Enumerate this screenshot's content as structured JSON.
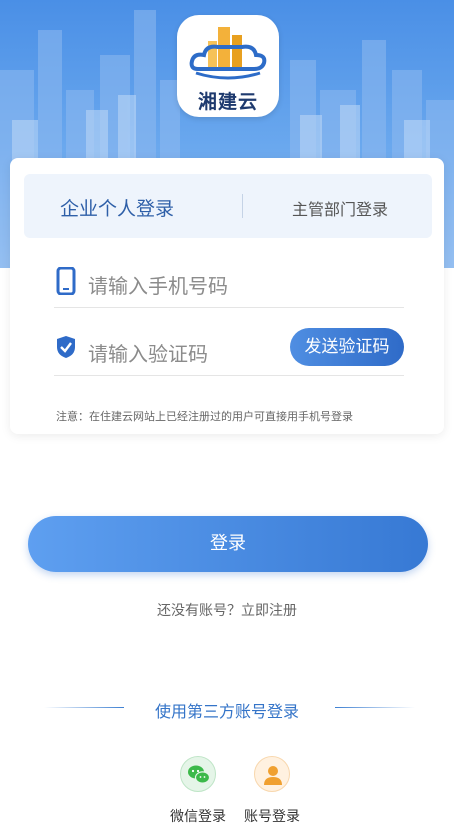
{
  "app": {
    "logo_text": "湘建云"
  },
  "tabs": {
    "active": "企业个人登录",
    "other": "主管部门登录"
  },
  "phone_field": {
    "placeholder": "请输入手机号码"
  },
  "code_field": {
    "placeholder": "请输入验证码",
    "send_button": "发送验证码"
  },
  "notice": "注意：在住建云网站上已经注册过的用户可直接用手机号登录",
  "login_button": "登录",
  "register_prompt": "还没有账号？立即注册",
  "third_party": {
    "title": "使用第三方账号登录",
    "options": [
      {
        "label": "微信登录",
        "icon": "wechat-icon"
      },
      {
        "label": "账号登录",
        "icon": "user-icon"
      }
    ]
  },
  "colors": {
    "primary": "#3779d4",
    "tab_text": "#2e5fa8",
    "wechat": "#3cb94a",
    "account": "#f0a030"
  }
}
